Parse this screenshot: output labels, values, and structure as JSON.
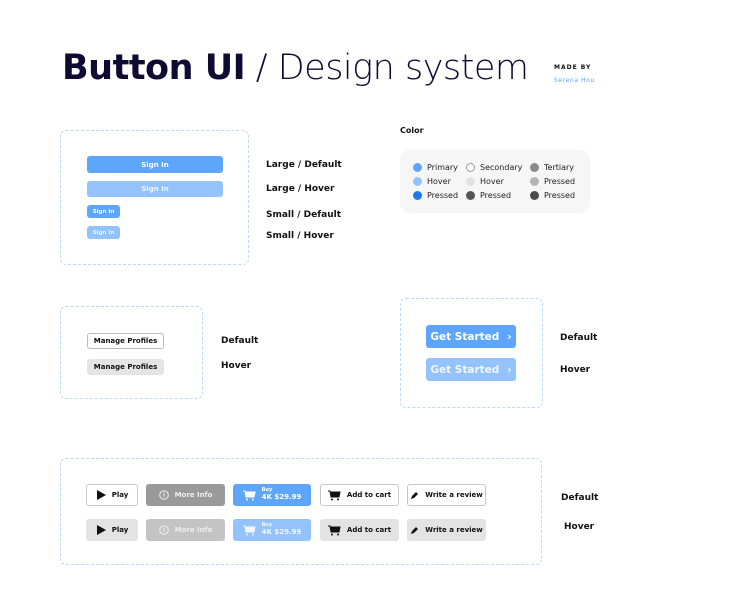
{
  "header": {
    "title_bold": "Button UI",
    "title_light": "/ Design system",
    "made_by": "MADE BY",
    "author": "Serena Hou"
  },
  "signin": {
    "label": "Sign In",
    "states": [
      "Large / Default",
      "Large / Hover",
      "Small / Default",
      "Small / Hover"
    ]
  },
  "color": {
    "heading": "Color",
    "columns": [
      {
        "items": [
          {
            "label": "Primary",
            "color": "#5ea6fb"
          },
          {
            "label": "Hover",
            "color": "#94c3fc"
          },
          {
            "label": "Pressed",
            "color": "#1f7ae8"
          }
        ]
      },
      {
        "items": [
          {
            "label": "Secondary",
            "color": "#ffffff"
          },
          {
            "label": "Hover",
            "color": "#e2e2e2"
          },
          {
            "label": "Pressed",
            "color": "#555555"
          }
        ]
      },
      {
        "items": [
          {
            "label": "Tertiary",
            "color": "#8a8a8a"
          },
          {
            "label": "Pressed",
            "color": "#b5b5b5"
          },
          {
            "label": "Pressed",
            "color": "#4a4a4a"
          }
        ]
      }
    ]
  },
  "manage": {
    "label": "Manage Profiles",
    "states": [
      "Default",
      "Hover"
    ]
  },
  "get_started": {
    "label": "Get Started",
    "states": [
      "Default",
      "Hover"
    ]
  },
  "actions": {
    "play": "Play",
    "more_info": "More Info",
    "buy_top": "Buy",
    "buy_price": "4K $29.99",
    "add_to_cart": "Add to cart",
    "write_review": "Write a review",
    "states": [
      "Default",
      "Hover"
    ]
  }
}
